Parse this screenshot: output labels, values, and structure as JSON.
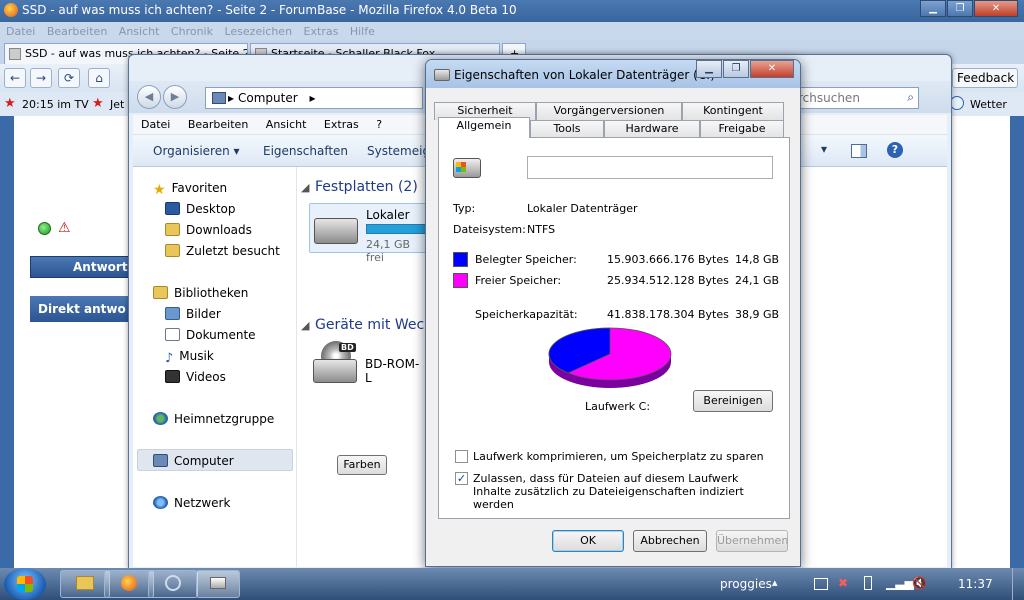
{
  "firefox": {
    "title": "SSD - auf was muss ich achten? - Seite 2 - ForumBase - Mozilla Firefox 4.0 Beta 10",
    "menu": [
      "Datei",
      "Bearbeiten",
      "Ansicht",
      "Chronik",
      "Lesezeichen",
      "Extras",
      "Hilfe"
    ],
    "tabs": [
      "SSD - auf was muss ich achten? - Seite 2 ...",
      "Startseite - Schaller Black Fox..."
    ],
    "feedback": "Feedback",
    "bookmarks": {
      "tv": "20:15 im TV",
      "jet": "Jet",
      "wetter1": "tter",
      "wetter2": "Wetter"
    },
    "search_placeholder": "rchsuchen",
    "forum": {
      "antwort": "Antwort",
      "direkt": "Direkt antwo"
    }
  },
  "explorer": {
    "address": "Computer",
    "menu": [
      "Datei",
      "Bearbeiten",
      "Ansicht",
      "Extras",
      "?"
    ],
    "toolbar": {
      "organize": "Organisieren ▾",
      "properties": "Eigenschaften",
      "system": "Systemeige"
    },
    "nav": {
      "favorites": "Favoriten",
      "desktop": "Desktop",
      "downloads": "Downloads",
      "recent": "Zuletzt besucht",
      "libraries": "Bibliotheken",
      "pictures": "Bilder",
      "documents": "Dokumente",
      "music": "Musik",
      "videos": "Videos",
      "homegroup": "Heimnetzgruppe",
      "computer": "Computer",
      "network": "Netzwerk"
    },
    "main": {
      "disks_header": "Festplatten (2)",
      "disk_name": "Lokaler Dat",
      "disk_free": "24,1 GB frei",
      "devices_header": "Geräte mit Wechs",
      "bd_label": "BD",
      "bd_name": "BD-ROM-L",
      "farben": "Farben"
    }
  },
  "dialog": {
    "title": "Eigenschaften von Lokaler Datenträger (C:)",
    "tabs_row1": [
      "Sicherheit",
      "Vorgängerversionen",
      "Kontingent"
    ],
    "tabs_row2": [
      "Allgemein",
      "Tools",
      "Hardware",
      "Freigabe"
    ],
    "name_value": "",
    "type_label": "Typ:",
    "type_value": "Lokaler Datenträger",
    "fs_label": "Dateisystem:",
    "fs_value": "NTFS",
    "used_label": "Belegter Speicher:",
    "used_bytes": "15.903.666.176 Bytes",
    "used_gb": "14,8 GB",
    "free_label": "Freier Speicher:",
    "free_bytes": "25.934.512.128 Bytes",
    "free_gb": "24,1 GB",
    "cap_label": "Speicherkapazität:",
    "cap_bytes": "41.838.178.304 Bytes",
    "cap_gb": "38,9 GB",
    "used_fraction": 0.38,
    "used_color": "#0000ff",
    "free_color": "#ff00ff",
    "drive_label": "Laufwerk C:",
    "cleanup": "Bereinigen",
    "compress": "Laufwerk komprimieren, um Speicherplatz zu sparen",
    "index": "Zulassen, dass für Dateien auf diesem Laufwerk Inhalte zusätzlich zu Dateieigenschaften indiziert werden",
    "ok": "OK",
    "cancel": "Abbrechen",
    "apply": "Übernehmen"
  },
  "taskbar": {
    "user": "proggies",
    "time": "11:37"
  }
}
